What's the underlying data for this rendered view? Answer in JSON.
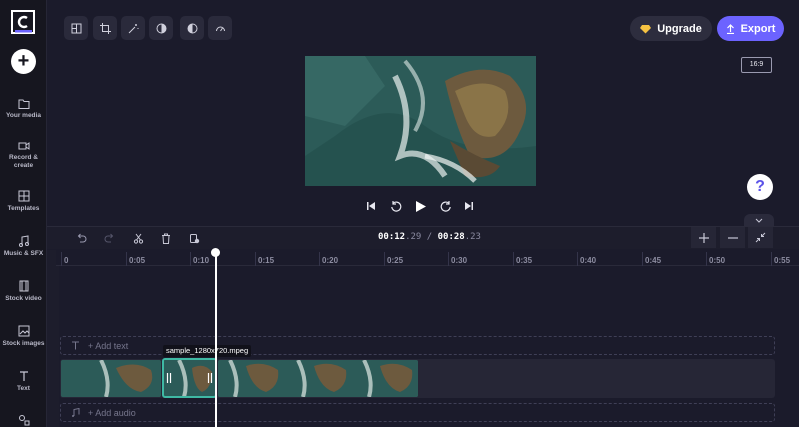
{
  "sidebar": {
    "items": [
      {
        "label": "Your media",
        "icon": "folder-icon"
      },
      {
        "label": "Record &",
        "label2": "create",
        "icon": "camera-icon"
      },
      {
        "label": "Templates",
        "icon": "templates-icon"
      },
      {
        "label": "Music & SFX",
        "icon": "music-icon"
      },
      {
        "label": "Stock video",
        "icon": "film-icon"
      },
      {
        "label": "Stock images",
        "icon": "image-icon"
      },
      {
        "label": "Text",
        "icon": "text-icon"
      },
      {
        "label": "",
        "icon": "shapes-icon"
      }
    ]
  },
  "header": {
    "upgrade_label": "Upgrade",
    "export_label": "Export",
    "aspect_ratio": "16:9"
  },
  "help": {
    "label": "?"
  },
  "timeline": {
    "current_time_main": "00:12",
    "current_time_frac": ".29",
    "separator": " / ",
    "total_time_main": "00:28",
    "total_time_frac": ".23",
    "ticks": [
      "0",
      "0:05",
      "0:10",
      "0:15",
      "0:20",
      "0:25",
      "0:30",
      "0:35",
      "0:40",
      "0:45",
      "0:50",
      "0:55"
    ],
    "add_text_label": "+ Add text",
    "add_audio_label": "+ Add audio",
    "selected_clip_name": "sample_1280x720.mpeg"
  },
  "colors": {
    "accent": "#6c63ff",
    "selection": "#3fb9a4",
    "background": "#1b1b2b"
  }
}
